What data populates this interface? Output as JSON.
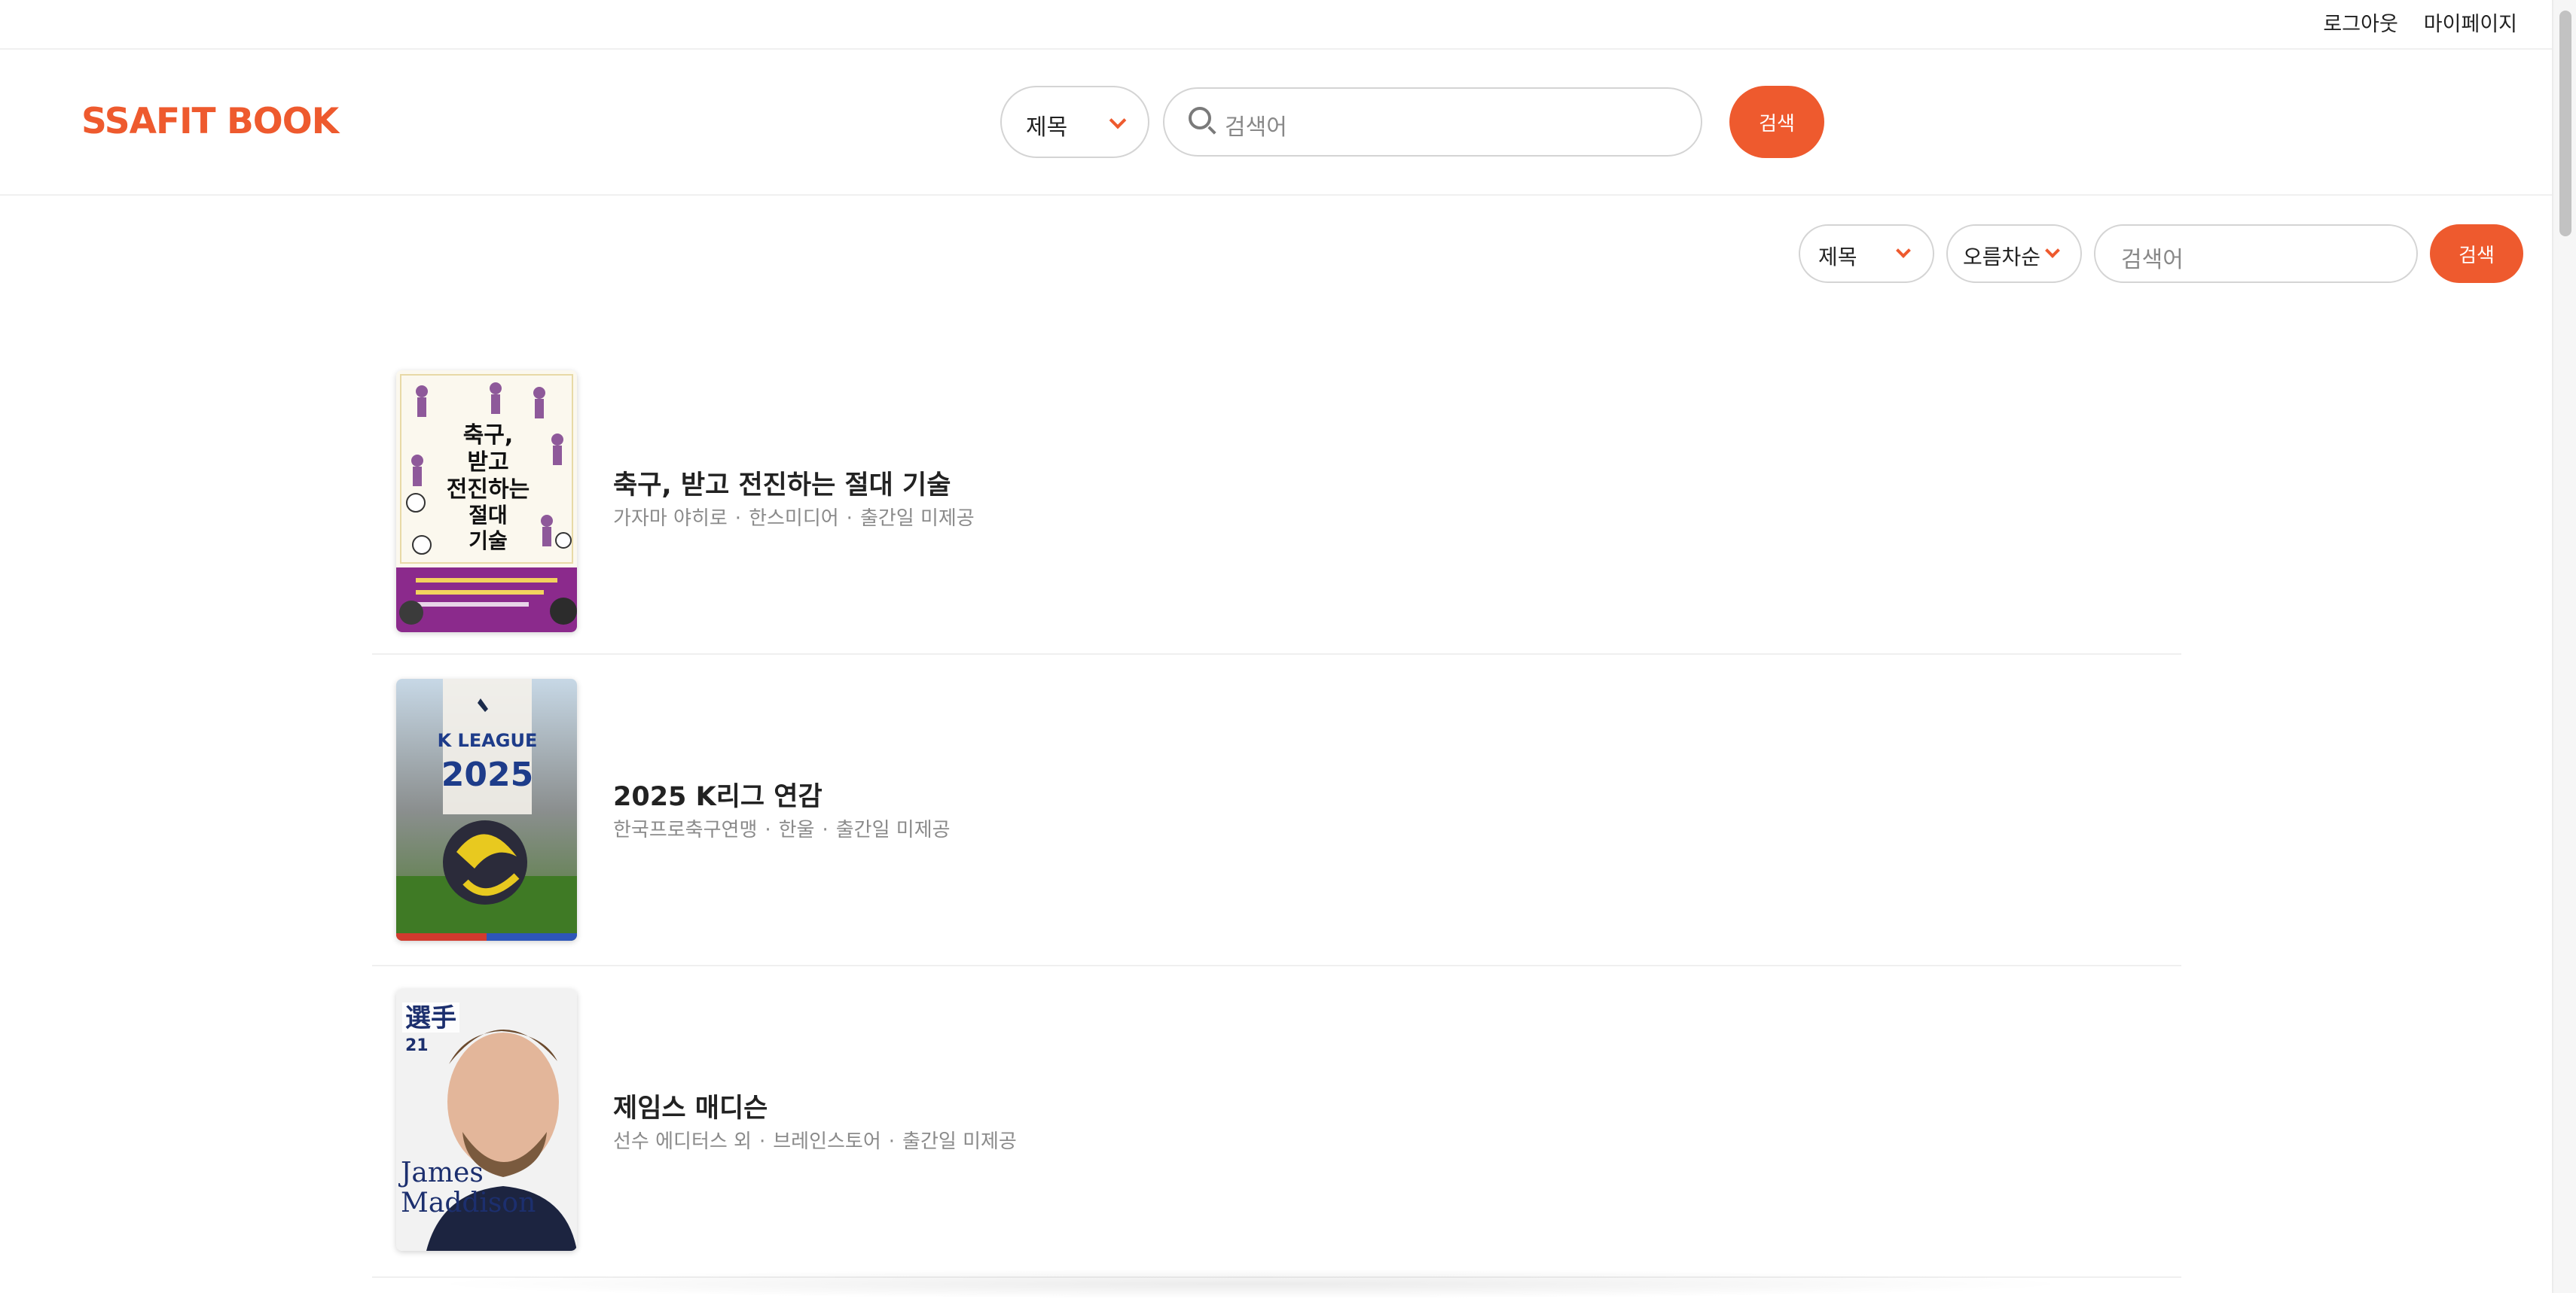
{
  "topbar": {
    "logout": "로그아웃",
    "mypage": "마이페이지"
  },
  "header": {
    "logo": "SSAFIT BOOK",
    "filter_select": "제목",
    "search_placeholder": "검색어",
    "search_button": "검색"
  },
  "list_filter": {
    "field_select": "제목",
    "order_select": "오름차순",
    "search_placeholder": "검색어",
    "search_button": "검색"
  },
  "books": [
    {
      "title": "축구, 받고 전진하는 절대 기술",
      "author": "가자마 야히로",
      "publisher": "한스미디어",
      "date": "출간일 미제공",
      "cover_text": [
        "축구,",
        "받고",
        "전진하는",
        "절대",
        "기술"
      ]
    },
    {
      "title": "2025 K리그 연감",
      "author": "한국프로축구연맹",
      "publisher": "한울",
      "date": "출간일 미제공",
      "cover_text": [
        "K LEAGUE",
        "2025"
      ]
    },
    {
      "title": "제임스 매디슨",
      "author": "선수 에디터스 외",
      "publisher": "브레인스토어",
      "date": "출간일 미제공",
      "cover_text": [
        "選手",
        "21",
        "James",
        "Maddison"
      ]
    }
  ],
  "meta_separator": "·",
  "colors": {
    "accent": "#ee5a2e",
    "text": "#222222",
    "muted": "#8a8a8a"
  }
}
